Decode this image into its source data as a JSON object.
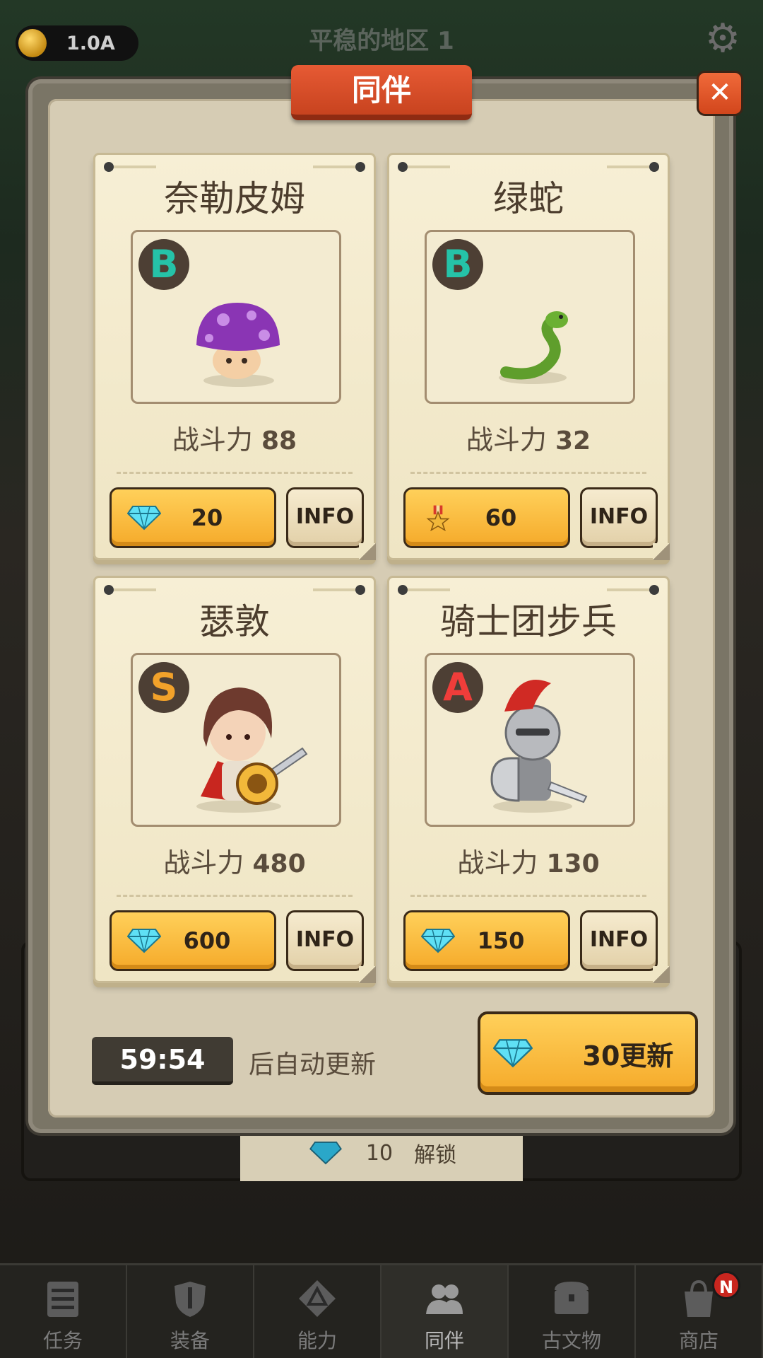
{
  "hud": {
    "coin_value": "1.0A",
    "region_title": "平稳的地区 1"
  },
  "modal": {
    "title": "同伴"
  },
  "companions": [
    {
      "name": "奈勒皮姆",
      "rank": "B",
      "power_label": "战斗力",
      "power": "88",
      "cost": "20",
      "currency": "diamond-icon",
      "info_label": "INFO"
    },
    {
      "name": "绿蛇",
      "rank": "B",
      "power_label": "战斗力",
      "power": "32",
      "cost": "60",
      "currency": "medal-icon",
      "info_label": "INFO"
    },
    {
      "name": "瑟敦",
      "rank": "S",
      "power_label": "战斗力",
      "power": "480",
      "cost": "600",
      "currency": "diamond-icon",
      "info_label": "INFO"
    },
    {
      "name": "骑士团步兵",
      "rank": "A",
      "power_label": "战斗力",
      "power": "130",
      "cost": "150",
      "currency": "diamond-icon",
      "info_label": "INFO"
    }
  ],
  "footer": {
    "timer": "59:54",
    "auto_refresh_text": "后自动更新",
    "refresh_label": "30更新"
  },
  "background": {
    "slot_value": "10",
    "slot_label": "解锁"
  },
  "nav": {
    "items": [
      {
        "label": "任务",
        "icon": "quest-icon"
      },
      {
        "label": "装备",
        "icon": "equipment-icon"
      },
      {
        "label": "能力",
        "icon": "ability-icon"
      },
      {
        "label": "同伴",
        "icon": "companion-icon"
      },
      {
        "label": "古文物",
        "icon": "artifact-icon"
      },
      {
        "label": "商店",
        "icon": "shop-icon"
      }
    ],
    "active": "同伴",
    "shop_badge": "N"
  },
  "colors": {
    "accent_orange": "#f5aa2a",
    "banner_red": "#d2461c",
    "rank_B": "#25c3a8",
    "rank_S": "#f2a22a",
    "rank_A": "#ef3d3a"
  }
}
